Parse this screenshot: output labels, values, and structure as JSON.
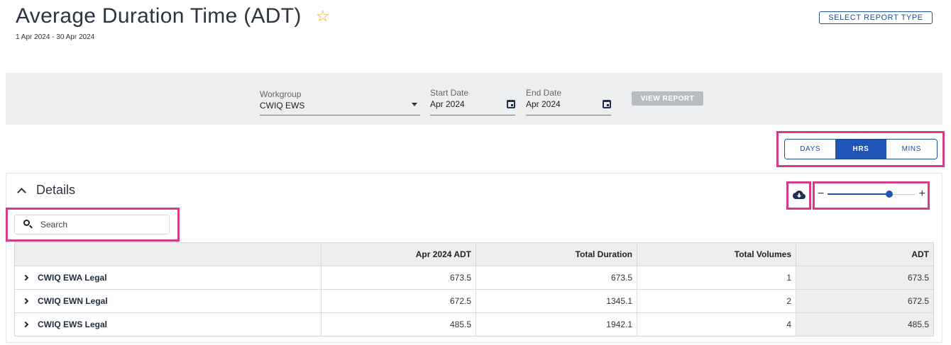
{
  "header": {
    "title": "Average Duration Time (ADT)",
    "favorite_icon": "star-icon",
    "date_range": "1 Apr 2024 - 30 Apr 2024",
    "select_report_type_label": "SELECT REPORT TYPE"
  },
  "filters": {
    "workgroup": {
      "label": "Workgroup",
      "value": "CWIQ EWS"
    },
    "start_date": {
      "label": "Start Date",
      "value": "Apr 2024"
    },
    "end_date": {
      "label": "End Date",
      "value": "Apr 2024"
    },
    "view_report_label": "VIEW REPORT"
  },
  "units": {
    "options": [
      "DAYS",
      "HRS",
      "MINS"
    ],
    "selected": "HRS"
  },
  "details": {
    "title": "Details",
    "search_placeholder": "Search",
    "zoom": {
      "minus": "−",
      "plus": "+",
      "level": 0.7
    },
    "columns": [
      "",
      "Apr 2024 ADT",
      "Total Duration",
      "Total Volumes",
      "ADT"
    ],
    "rows": [
      {
        "name": "CWIQ EWA Legal",
        "apr_adt": "673.5",
        "total_duration": "673.5",
        "total_volumes": "1",
        "adt": "673.5"
      },
      {
        "name": "CWIQ EWN Legal",
        "apr_adt": "672.5",
        "total_duration": "1345.1",
        "total_volumes": "2",
        "adt": "672.5"
      },
      {
        "name": "CWIQ EWS Legal",
        "apr_adt": "485.5",
        "total_duration": "1942.1",
        "total_volumes": "4",
        "adt": "485.5"
      }
    ]
  },
  "colors": {
    "accent": "#1f55b6",
    "highlight": "#d63a86",
    "star": "#f0a500"
  }
}
